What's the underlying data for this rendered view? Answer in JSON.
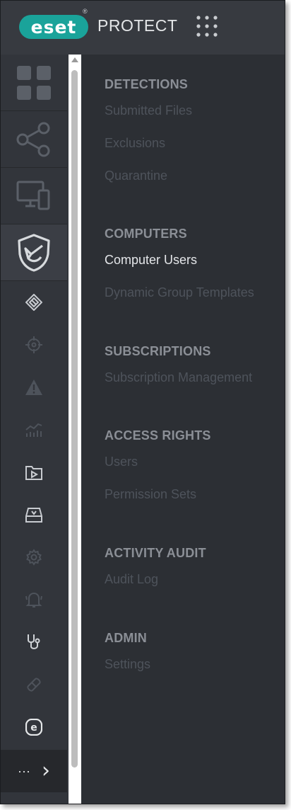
{
  "header": {
    "logo_text": "eset",
    "logo_reg": "®",
    "product_name": "PROTECT",
    "apps_icon": "grid-dots-icon"
  },
  "rail": {
    "large_items": [
      {
        "icon": "dashboard-tiles-icon",
        "active": false
      },
      {
        "icon": "network-share-icon",
        "active": false
      },
      {
        "icon": "computers-icon",
        "active": false
      },
      {
        "icon": "shield-detections-icon",
        "active": true
      }
    ],
    "small_items": [
      {
        "icon": "layers-icon"
      },
      {
        "icon": "crosshair-icon"
      },
      {
        "icon": "warning-icon"
      },
      {
        "icon": "chart-icon"
      },
      {
        "icon": "play-folder-icon"
      },
      {
        "icon": "inbox-icon"
      },
      {
        "icon": "gear-icon"
      },
      {
        "icon": "bell-icon"
      },
      {
        "icon": "stethoscope-icon"
      },
      {
        "icon": "pill-icon"
      },
      {
        "icon": "e-badge-icon"
      }
    ],
    "more_label": "···",
    "more_arrow": "›"
  },
  "menu": {
    "sections": [
      {
        "heading": "DETECTIONS",
        "items": [
          {
            "label": "Submitted Files",
            "active": false
          },
          {
            "label": "Exclusions",
            "active": false
          },
          {
            "label": "Quarantine",
            "active": false
          }
        ]
      },
      {
        "heading": "COMPUTERS",
        "items": [
          {
            "label": "Computer Users",
            "active": true
          },
          {
            "label": "Dynamic Group Templates",
            "active": false
          }
        ]
      },
      {
        "heading": "SUBSCRIPTIONS",
        "items": [
          {
            "label": "Subscription Management",
            "active": false
          }
        ]
      },
      {
        "heading": "ACCESS RIGHTS",
        "items": [
          {
            "label": "Users",
            "active": false
          },
          {
            "label": "Permission Sets",
            "active": false
          }
        ]
      },
      {
        "heading": "ACTIVITY AUDIT",
        "items": [
          {
            "label": "Audit Log",
            "active": false
          }
        ]
      },
      {
        "heading": "ADMIN",
        "items": [
          {
            "label": "Settings",
            "active": false
          }
        ]
      }
    ]
  },
  "colors": {
    "brand": "#1aa39a",
    "background": "#2c2f34",
    "heading": "#8b8f96",
    "active_item": "#e4e6e9",
    "disabled_item": "#4e535b"
  }
}
